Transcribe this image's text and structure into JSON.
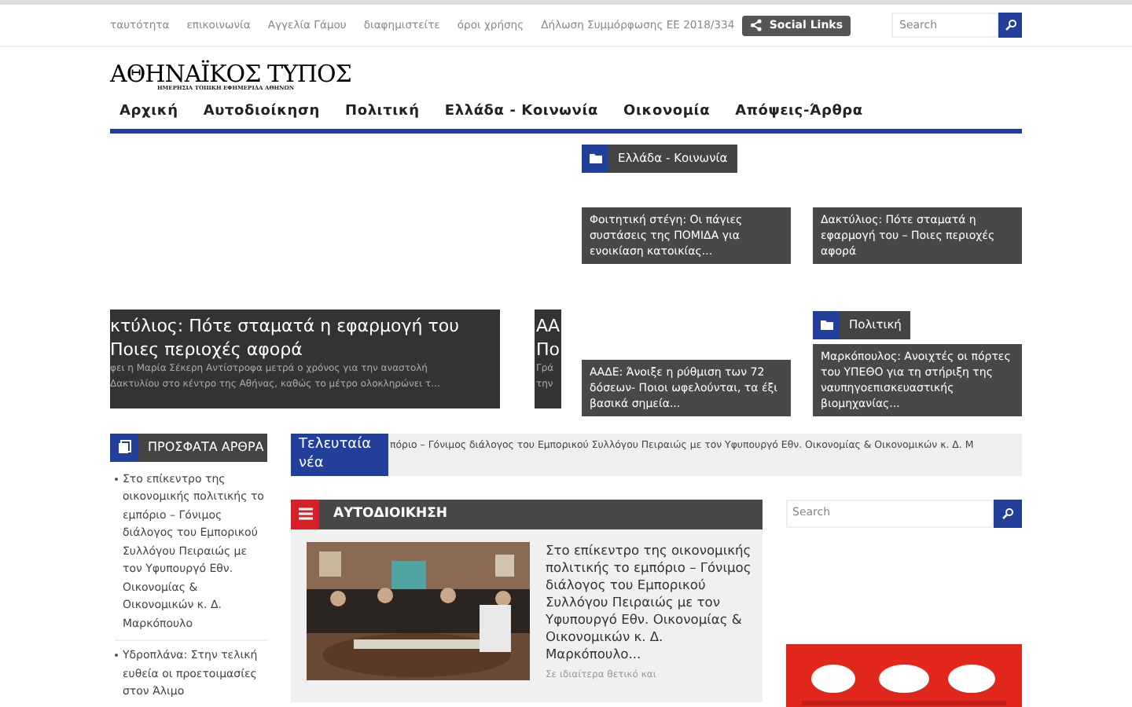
{
  "top_links": [
    "ταυτότητα",
    "επικοινωνία",
    "Αγγελία Γάμου",
    "διαφημιστείτε",
    "όροι χρήσης",
    "Δήλωση Συμμόρφωσης ΕΕ 2018/334"
  ],
  "social_button": "Social Links",
  "top_search": {
    "placeholder": "Search"
  },
  "logo": {
    "title": "ΑΘΗΝΑΪΚΟΣ ΤΥΠΟΣ",
    "subtitle": "ΗΜΕΡΗΣΙΑ ΤΟΠΙΚΗ ΕΦΗΜΕΡΙΔΑ ΑΘΗΝΩΝ"
  },
  "nav": [
    "Αρχική",
    "Αυτοδιοίκηση",
    "Πολιτική",
    "Ελλάδα - Κοινωνία",
    "Οικονομία",
    "Απόψεις-Άρθρα"
  ],
  "slider": [
    {
      "title_lines": [
        "κτύλιος: Πότε σταματά η εφαρμογή του",
        "Ποιες περιοχές αφορά"
      ],
      "excerpt_lines": [
        "φει η Μαρία Σέκερη Αντίστροφα μετρά ο χρόνος για την αναστολή",
        "Δακτυλίου στο κέντρο της Αθήνας, καθώς το μέτρο ολοκληρώνει τ..."
      ]
    },
    {
      "title_lines": [
        "ΑΑ",
        "Πο"
      ],
      "excerpt_lines": [
        "Γρά",
        "την"
      ]
    }
  ],
  "grid": [
    {
      "category": "Ελλάδα - Κοινωνία",
      "title": "Φοιτητική στέγη: Οι πάγιες συστάσεις της ΠΟΜΙΔΑ για ενοικίαση κατοικίας..."
    },
    {
      "title": "Δακτύλιος: Πότε σταματά η εφαρμογή του – Ποιες περιοχές αφορά"
    },
    {
      "title": "ΑΑΔΕ: Άνοιξε η ρύθμιση των 72 δόσεων- Ποιοι ωφελούνται, τα έξι βασικά σημεία..."
    },
    {
      "category": "Πολιτική",
      "title": "Μαρκόπουλος: Ανοιχτές οι πόρτες του ΥΠΕΘΟ για τη στήριξη της ναυπηγοεπισκευαστικής βιομηχανίας..."
    }
  ],
  "recent": {
    "title": "ΠΡΟΣΦΑΤΑ ΑΡΘΡΑ",
    "items": [
      "Στο επίκεντρο της οικονομικής πολιτικής το εμπόριο – Γόνιμος διάλογος του Εμπορικού Συλλόγου Πειραιώς με τον Υφυπουργό Εθν. Οικονομίας & Οικονομικών κ. Δ. Μαρκόπουλο",
      "Υδροπλάνα: Στην τελική ευθεία οι προετοιμασίες στον Άλιμο"
    ]
  },
  "ticker": {
    "label": "Τελευταία νέα",
    "text": "πόριο – Γόνιμος διάλογος του Εμπορικού Συλλόγου Πειραιώς με τον Υφυπουργό Εθν. Οικονομίας & Οικονομικών κ. Δ. Μ"
  },
  "section": {
    "title": "ΑΥΤΟΔΙΟΙΚΗΣΗ",
    "article": {
      "title": "Στο επίκεντρο της οικονομικής πολιτικής το εμπόριο – Γόνιμος διάλογος του Εμπορικού Συλλόγου Πειραιώς με τον Υφυπουργό Εθν. Οικονομίας & Οικονομικών κ. Δ. Μαρκόπουλο...",
      "excerpt": "Σε ιδιαίτερα θετικό και"
    }
  },
  "side_search": {
    "placeholder": "Search"
  }
}
